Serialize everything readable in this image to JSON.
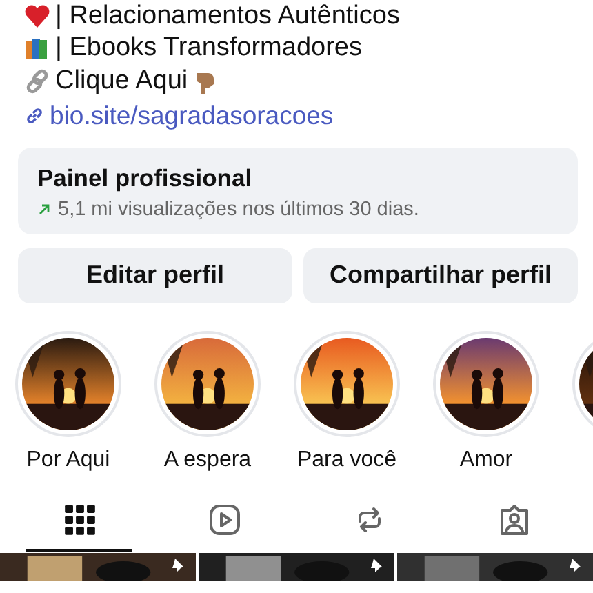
{
  "bio": [
    {
      "kind": "heart",
      "text": "| Relacionamentos Autênticos"
    },
    {
      "kind": "books",
      "text": "| Ebooks Transformadores"
    },
    {
      "kind": "chain",
      "text": "Clique Aqui",
      "hand": true
    }
  ],
  "link": "bio.site/sagradasoracoes",
  "dashboard": {
    "title": "Painel profissional",
    "subtitle": "5,1 mi visualizações nos últimos 30 dias."
  },
  "buttons": [
    "Editar perfil",
    "Compartilhar perfil"
  ],
  "highlights": [
    {
      "label": "Por Aqui",
      "kind": "picture"
    },
    {
      "label": "A espera",
      "kind": "picture"
    },
    {
      "label": "Para você",
      "kind": "picture"
    },
    {
      "label": "Amor",
      "kind": "picture"
    },
    {
      "kind": "picture"
    }
  ],
  "tabs": [
    {
      "kind": "grid",
      "selected": true
    },
    {
      "kind": "reels",
      "selected": false
    },
    {
      "kind": "reposts",
      "selected": false
    },
    {
      "kind": "tagged",
      "selected": false
    }
  ],
  "posts": [
    {
      "kind": "picture",
      "pinned": true
    },
    {
      "kind": "picture",
      "pinned": true
    },
    {
      "kind": "picture",
      "pinned": true
    }
  ]
}
